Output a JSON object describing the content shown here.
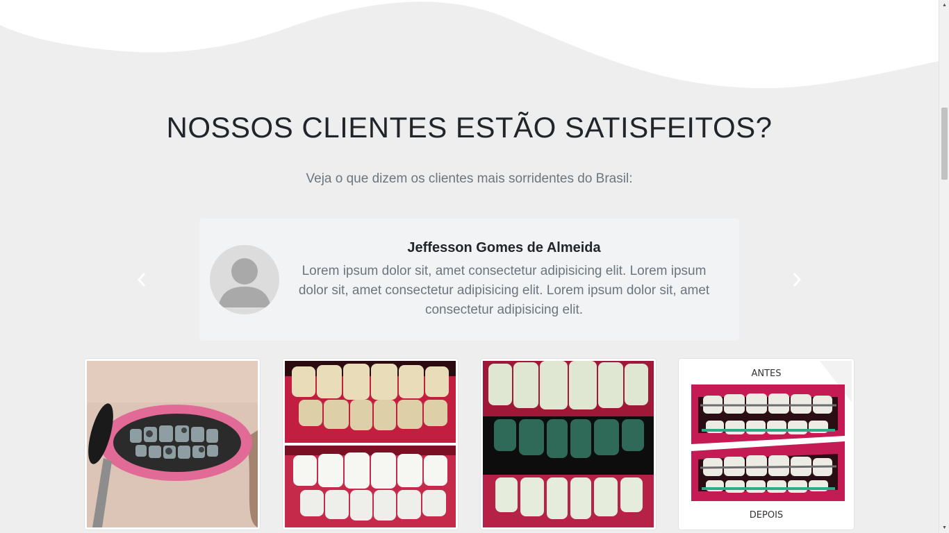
{
  "testimonials": {
    "title": "NOSSOS CLIENTES ESTÃO SATISFEITOS?",
    "subtitle": "Veja o que dizem os clientes mais sorridentes do Brasil:",
    "carousel": {
      "prev_icon": "chevron-left-icon",
      "next_icon": "chevron-right-icon",
      "active_item": {
        "name": "Jeffesson Gomes de Almeida",
        "text": "Lorem ipsum dolor sit, amet consectetur adipisicing elit. Lorem ipsum dolor sit, amet consectetur adipisicing elit. Lorem ipsum dolor sit, amet consectetur adipisicing elit.",
        "avatar_icon": "user-placeholder-icon"
      }
    }
  },
  "gallery": {
    "photos": [
      {
        "name": "charcoal-brushing-photo"
      },
      {
        "name": "whitening-before-after-photo"
      },
      {
        "name": "charcoal-teeth-before-after-photo"
      },
      {
        "name": "braces-before-after-photo",
        "caption_top": "ANTES",
        "caption_bottom": "DEPOIS"
      }
    ]
  },
  "colors": {
    "background": "#eeeeee",
    "wave": "#ffffff",
    "card": "#f2f3f4",
    "title": "#212529",
    "muted_text": "#6c757d"
  }
}
